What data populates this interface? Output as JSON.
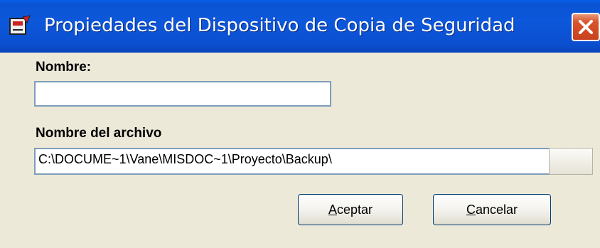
{
  "window": {
    "title": "Propiedades del Dispositivo de Copia de Seguridad"
  },
  "form": {
    "name_label": "Nombre:",
    "name_value": "",
    "file_label": "Nombre del archivo",
    "file_value": "C:\\DOCUME~1\\Vane\\MISDOC~1\\Proyecto\\Backup\\"
  },
  "buttons": {
    "ok_first": "A",
    "ok_rest": "ceptar",
    "cancel_first": "C",
    "cancel_rest": "ancelar"
  },
  "icons": {
    "app": "backup-device-icon",
    "close": "close-icon"
  },
  "colors": {
    "titlebar": "#0a54d4",
    "dialog_bg": "#ece9d8",
    "close_button": "#d9532b",
    "input_border": "#7f9db9"
  }
}
